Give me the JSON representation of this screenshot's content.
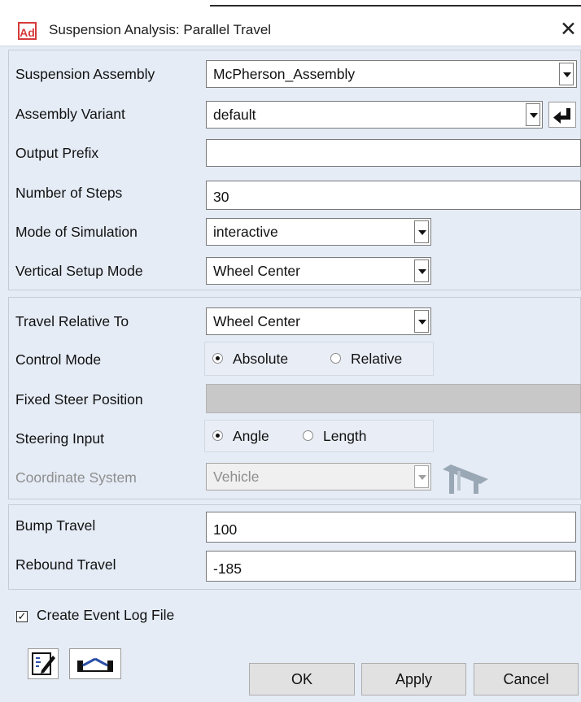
{
  "window": {
    "app_icon": "Ad",
    "title": "Suspension Analysis: Parallel Travel",
    "close_glyph": "✕"
  },
  "fields": {
    "suspension_assembly": {
      "label": "Suspension Assembly",
      "value": "McPherson_Assembly"
    },
    "assembly_variant": {
      "label": "Assembly Variant",
      "value": "default"
    },
    "output_prefix": {
      "label": "Output Prefix",
      "value": ""
    },
    "number_of_steps": {
      "label": "Number of Steps",
      "value": "30"
    },
    "mode_of_simulation": {
      "label": "Mode of Simulation",
      "value": "interactive"
    },
    "vertical_setup_mode": {
      "label": "Vertical Setup Mode",
      "value": "Wheel Center"
    },
    "travel_relative_to": {
      "label": "Travel Relative To",
      "value": "Wheel Center"
    },
    "control_mode": {
      "label": "Control Mode",
      "options": [
        "Absolute",
        "Relative"
      ],
      "selected": "Absolute"
    },
    "fixed_steer_position": {
      "label": "Fixed Steer Position",
      "value": ""
    },
    "steering_input": {
      "label": "Steering Input",
      "options": [
        "Angle",
        "Length"
      ],
      "selected": "Angle"
    },
    "coordinate_system": {
      "label": "Coordinate System",
      "value": "Vehicle"
    },
    "bump_travel": {
      "label": "Bump Travel",
      "value": "100"
    },
    "rebound_travel": {
      "label": "Rebound Travel",
      "value": "-185"
    }
  },
  "create_event_log": {
    "label": "Create Event Log File",
    "checked": true
  },
  "buttons": {
    "ok": "OK",
    "apply": "Apply",
    "cancel": "Cancel"
  },
  "icons": {
    "enter": "enter-arrow-icon",
    "coordinate_system": "vehicle-coordinate-icon",
    "edit": "edit-notes-icon",
    "suspension": "suspension-geometry-icon"
  },
  "colors": {
    "dialog_bg": "#e5ecf6",
    "app_icon_red": "#d63a3a"
  }
}
